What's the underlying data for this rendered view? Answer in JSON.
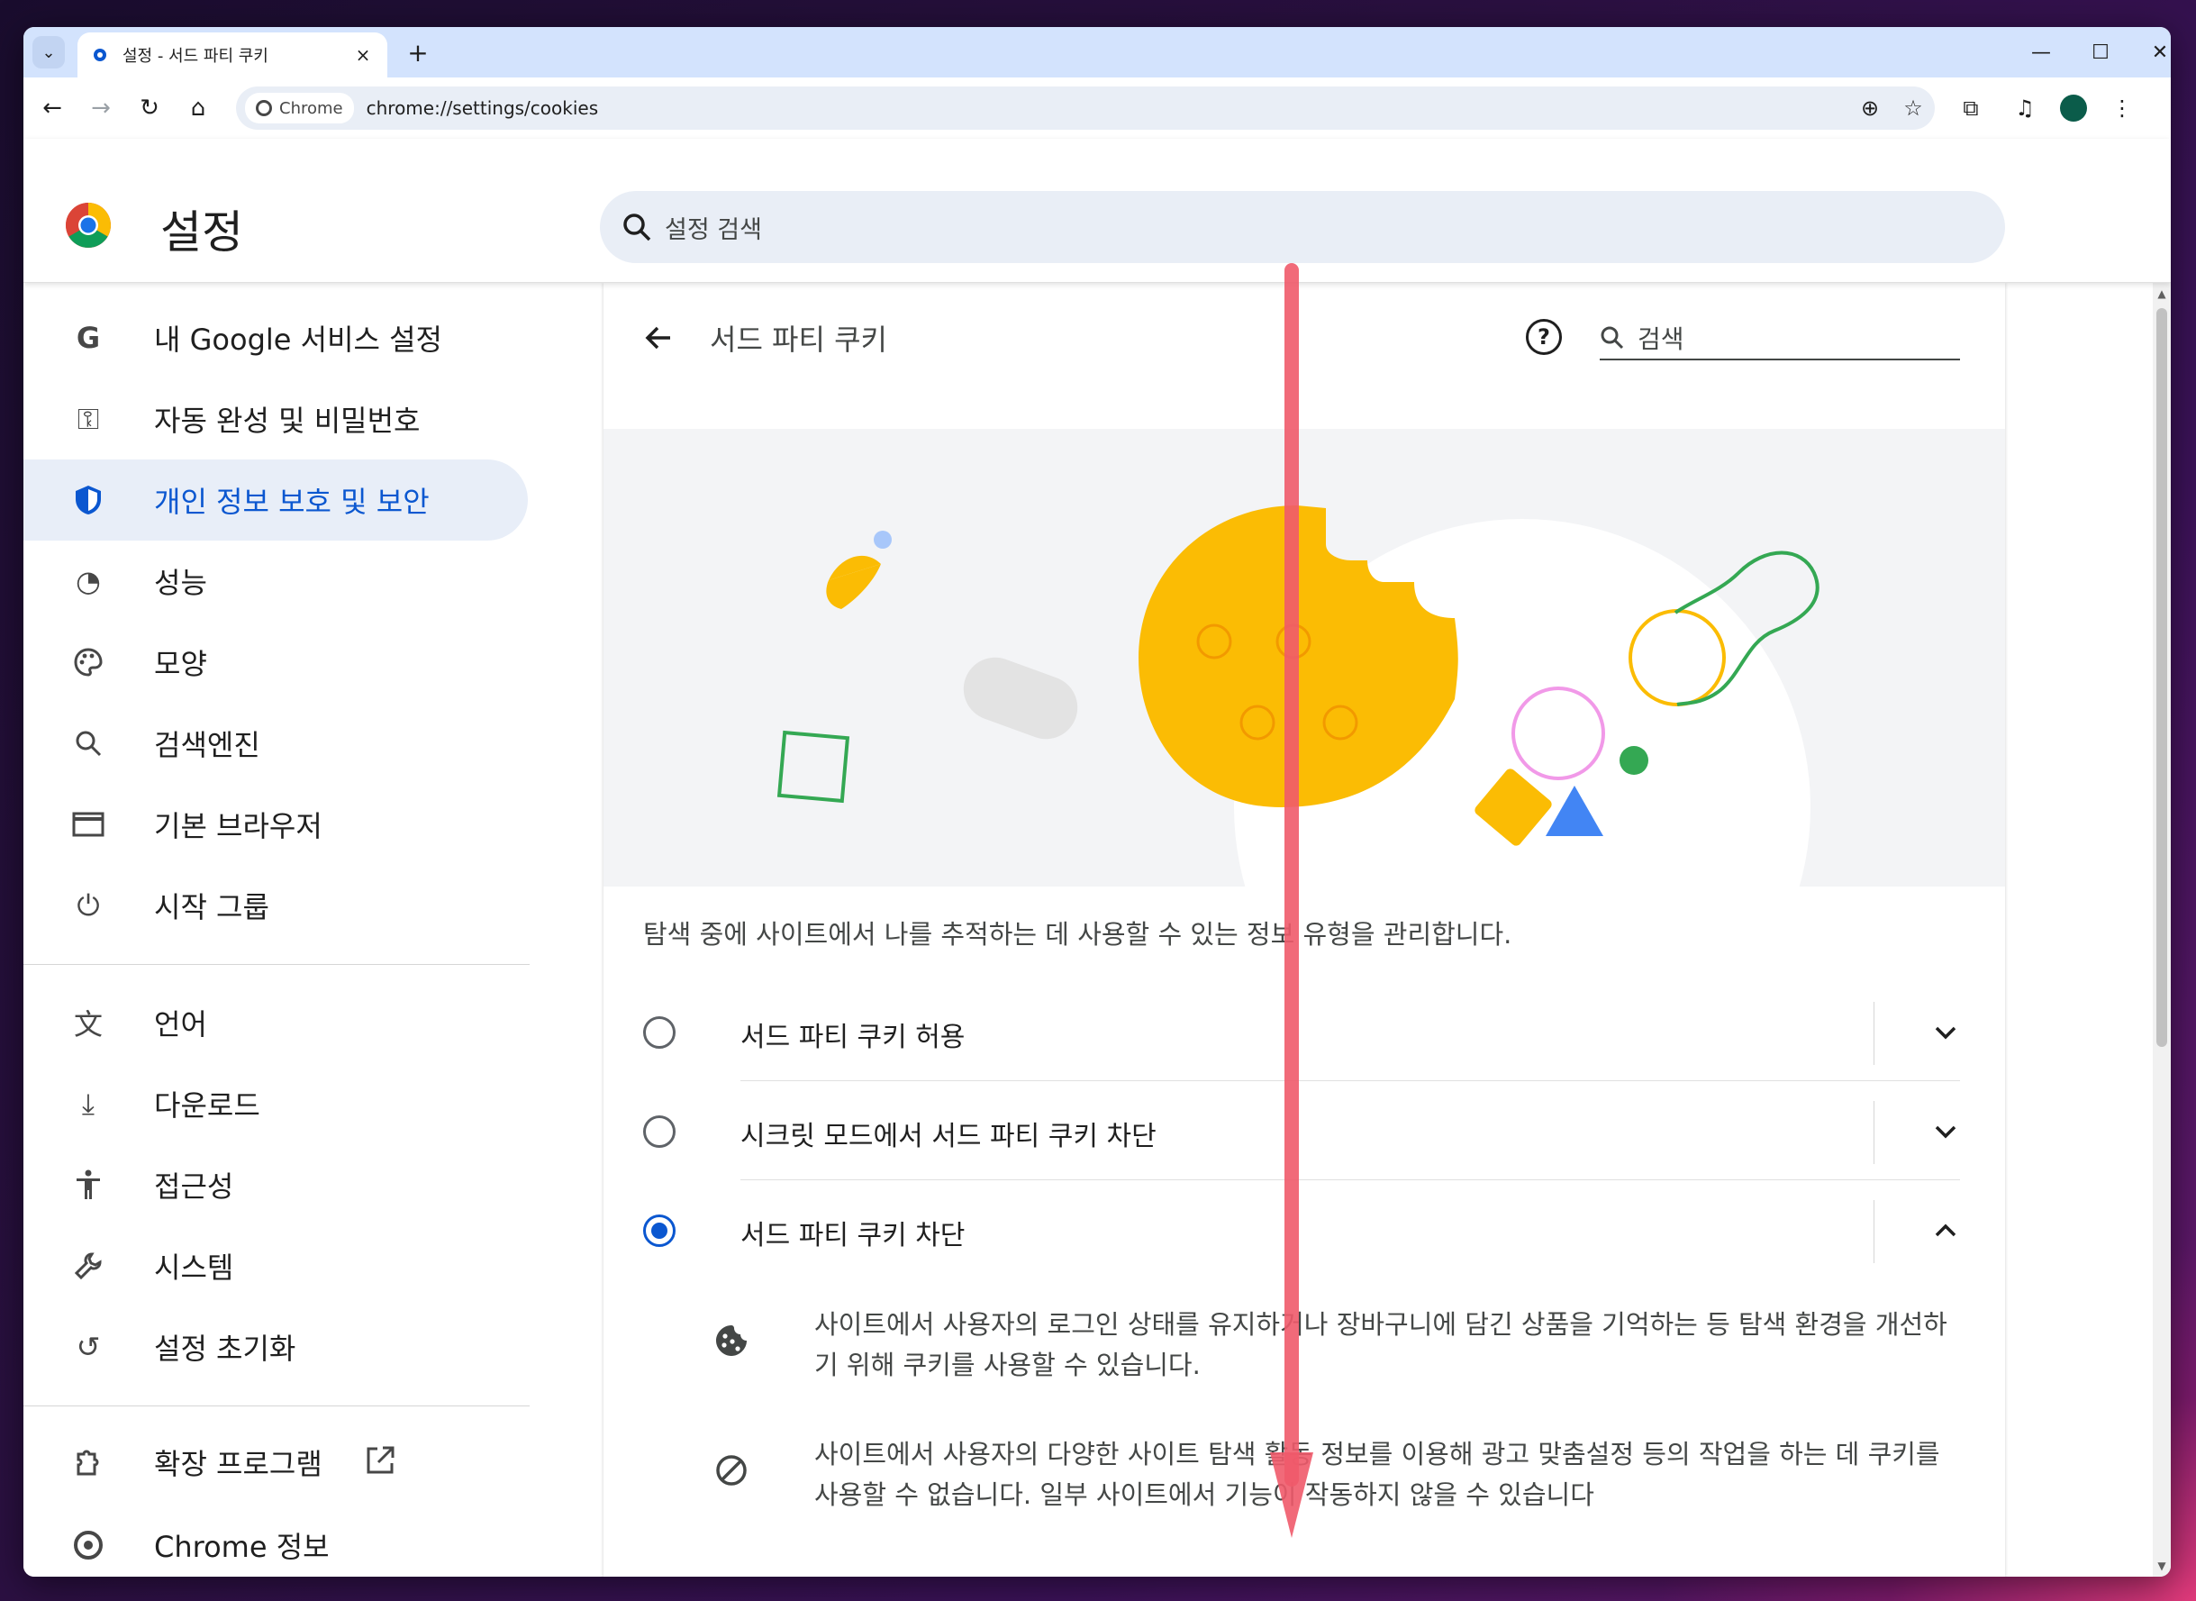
{
  "tab": {
    "title": "설정 - 서드 파티 쿠키",
    "close": "×",
    "new_tab": "+"
  },
  "window_controls": {
    "minimize": "—",
    "maximize": "☐",
    "close": "✕"
  },
  "toolbar": {
    "back": "←",
    "forward": "→",
    "reload": "↻",
    "home": "⌂",
    "chip_label": "Chrome",
    "url": "chrome://settings/cookies"
  },
  "settings_header": {
    "title": "설정",
    "search_placeholder": "설정 검색"
  },
  "sidebar": {
    "items": [
      {
        "label": "내 Google 서비스 설정",
        "icon": "google-g-icon",
        "glyph": "G"
      },
      {
        "label": "자동 완성 및 비밀번호",
        "icon": "key-icon",
        "glyph": "⚿"
      },
      {
        "label": "개인 정보 보호 및 보안",
        "icon": "shield-icon",
        "glyph": "⛨",
        "active": true
      },
      {
        "label": "성능",
        "icon": "speedometer-icon",
        "glyph": "◔"
      },
      {
        "label": "모양",
        "icon": "palette-icon",
        "glyph": "🎨"
      },
      {
        "label": "검색엔진",
        "icon": "search-icon",
        "glyph": "⌕"
      },
      {
        "label": "기본 브라우저",
        "icon": "browser-window-icon",
        "glyph": "▭"
      },
      {
        "label": "시작 그룹",
        "icon": "power-icon",
        "glyph": "⏻"
      },
      {
        "label": "언어",
        "icon": "translate-icon",
        "glyph": "文"
      },
      {
        "label": "다운로드",
        "icon": "download-icon",
        "glyph": "⤓"
      },
      {
        "label": "접근성",
        "icon": "accessibility-icon",
        "glyph": "♿"
      },
      {
        "label": "시스템",
        "icon": "wrench-icon",
        "glyph": "🔧"
      },
      {
        "label": "설정 초기화",
        "icon": "reset-icon",
        "glyph": "↺"
      },
      {
        "label": "확장 프로그램",
        "icon": "extension-icon",
        "glyph": "⧉"
      },
      {
        "label": "Chrome 정보",
        "icon": "chrome-icon",
        "glyph": "◎"
      }
    ]
  },
  "page": {
    "title": "서드 파티 쿠키",
    "search_placeholder": "검색",
    "description": "탐색 중에 사이트에서 나를 추적하는 데 사용할 수 있는 정보 유형을 관리합니다.",
    "options": [
      {
        "label": "서드 파티 쿠키 허용",
        "checked": false,
        "expanded": false
      },
      {
        "label": "시크릿 모드에서 서드 파티 쿠키 차단",
        "checked": false,
        "expanded": false
      },
      {
        "label": "서드 파티 쿠키 차단",
        "checked": true,
        "expanded": true
      }
    ],
    "details": [
      {
        "icon": "cookie-icon",
        "text": "사이트에서 사용자의 로그인 상태를 유지하거나 장바구니에 담긴 상품을 기억하는 등 탐색 환경을 개선하기 위해 쿠키를 사용할 수 있습니다."
      },
      {
        "icon": "block-icon",
        "text": "사이트에서 사용자의 다양한 사이트 탐색 활동 정보를 이용해 광고 맞춤설정 등의 작업을 하는 데 쿠키를 사용할 수 없습니다. 일부 사이트에서 기능이 작동하지 않을 수 있습니다"
      }
    ]
  },
  "colors": {
    "accent": "#0b57d0",
    "active_bg": "#e8eef8",
    "annotation": "#f05a6a",
    "cookie": "#fbbc04"
  }
}
